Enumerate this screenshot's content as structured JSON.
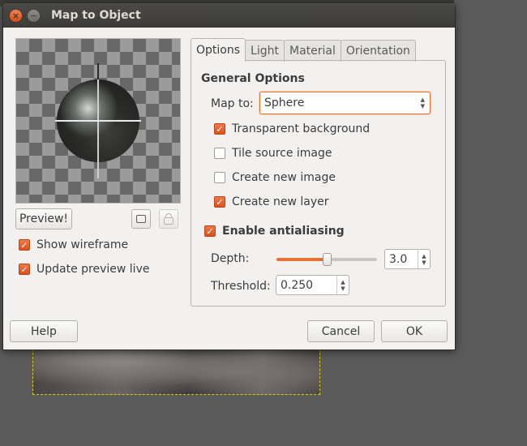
{
  "window": {
    "title": "Map to Object"
  },
  "preview": {
    "button_label": "Preview!"
  },
  "left_options": {
    "show_wireframe": {
      "label": "Show wireframe",
      "checked": true
    },
    "update_preview_live": {
      "label": "Update preview live",
      "checked": true
    }
  },
  "tabs": [
    {
      "label": "Options",
      "active": true
    },
    {
      "label": "Light",
      "active": false
    },
    {
      "label": "Material",
      "active": false
    },
    {
      "label": "Orientation",
      "active": false
    }
  ],
  "options": {
    "general_heading": "General Options",
    "map_to": {
      "label": "Map to:",
      "value": "Sphere"
    },
    "checkboxes": [
      {
        "label": "Transparent background",
        "checked": true
      },
      {
        "label": "Tile source image",
        "checked": false
      },
      {
        "label": "Create new image",
        "checked": false
      },
      {
        "label": "Create new layer",
        "checked": true
      }
    ],
    "antialiasing": {
      "label": "Enable antialiasing",
      "checked": true
    },
    "depth": {
      "label": "Depth:",
      "value": "3.0",
      "slider_fraction": 0.5
    },
    "threshold": {
      "label": "Threshold:",
      "value": "0.250"
    }
  },
  "buttons": {
    "help": "Help",
    "cancel": "Cancel",
    "ok": "OK"
  },
  "colors": {
    "accent": "#e9712f",
    "titlebar": "#3c3b37",
    "dialog_bg": "#f2f1f0"
  }
}
